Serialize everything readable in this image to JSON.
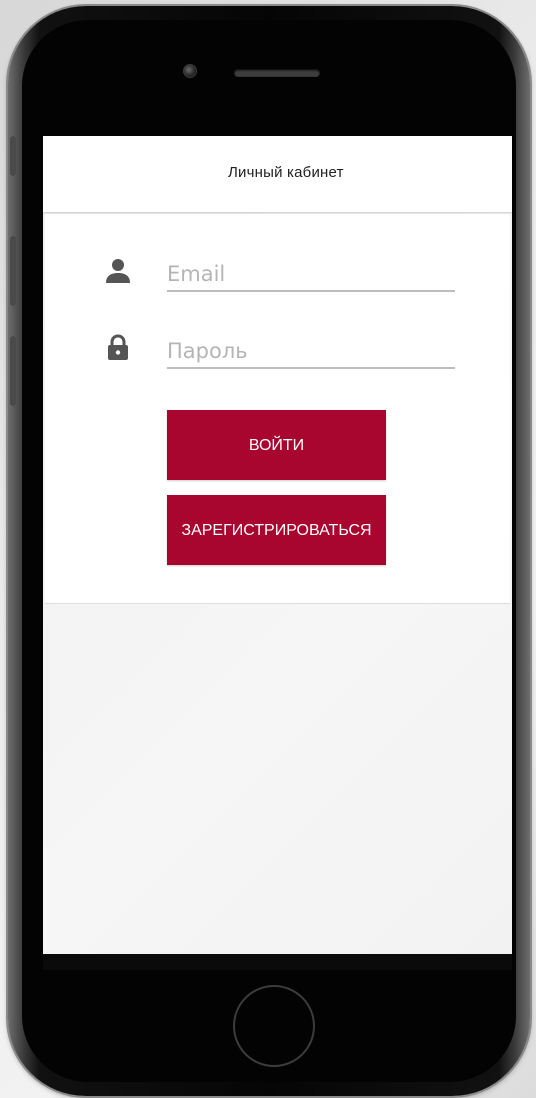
{
  "header": {
    "title": "Личный кабинет"
  },
  "login_form": {
    "email": {
      "placeholder": "Email",
      "value": "",
      "icon": "person-icon"
    },
    "password": {
      "placeholder": "Пароль",
      "value": "",
      "icon": "lock-icon"
    },
    "login_button_label": "ВОЙТИ",
    "register_button_label": "ЗАРЕГИСТРИРОВАТЬСЯ"
  },
  "colors": {
    "accent": "#a8062f",
    "icon": "#555555",
    "header_bg": "#ffffff",
    "screen_bg": "#f2f2f2"
  }
}
